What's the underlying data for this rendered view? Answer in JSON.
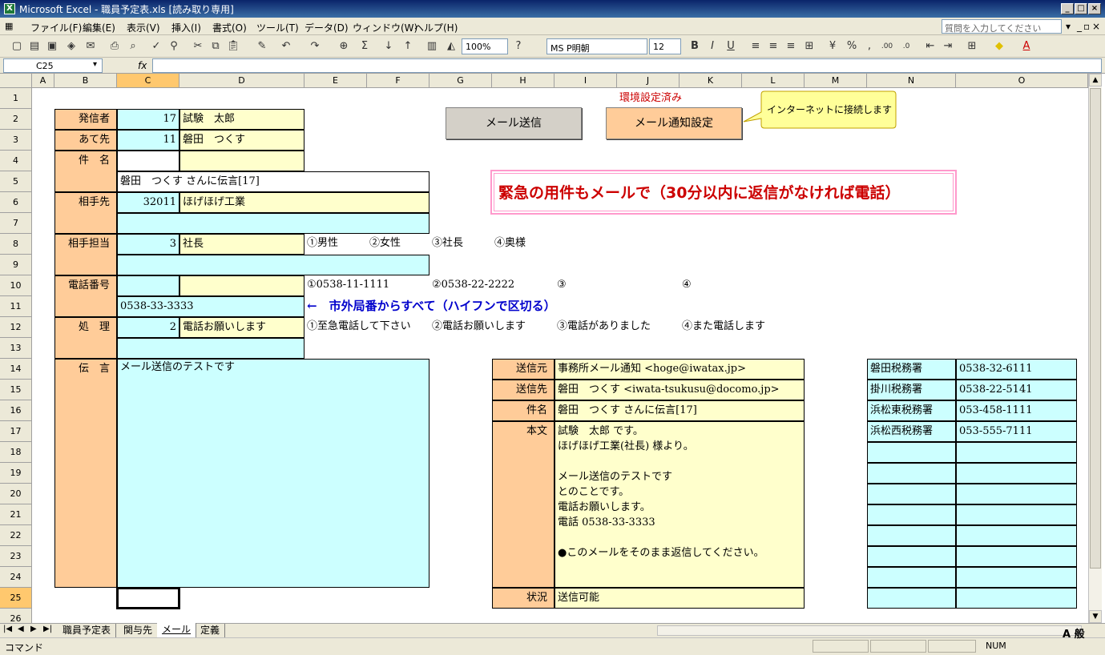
{
  "window": {
    "title": "Microsoft Excel - 職員予定表.xls  [読み取り専用]"
  },
  "menu": {
    "items": [
      "ファイル(F)",
      "編集(E)",
      "表示(V)",
      "挿入(I)",
      "書式(O)",
      "ツール(T)",
      "データ(D)",
      "ウィンドウ(W)",
      "ヘルプ(H)"
    ],
    "help_placeholder": "質問を入力してください"
  },
  "toolbar": {
    "zoom": "100%",
    "font_name": "MS P明朝",
    "font_size": "12"
  },
  "formula_bar": {
    "name_box": "C25",
    "fx": "fx"
  },
  "columns": [
    "A",
    "B",
    "C",
    "D",
    "E",
    "F",
    "G",
    "H",
    "I",
    "J",
    "K",
    "L",
    "M",
    "N",
    "O"
  ],
  "rows": [
    "1",
    "2",
    "3",
    "4",
    "5",
    "6",
    "7",
    "8",
    "9",
    "10",
    "11",
    "12",
    "13",
    "14",
    "15",
    "16",
    "17",
    "18",
    "19",
    "20",
    "21",
    "22",
    "23",
    "24",
    "25",
    "26"
  ],
  "form": {
    "sender_label": "発信者",
    "sender_id": "17",
    "sender_name": "試験　太郎",
    "to_label": "あて先",
    "to_id": "11",
    "to_name": "磐田　つくす",
    "subject_label": "件　名",
    "subject_value": "磐田　つくす さんに伝言[17]",
    "partner_label": "相手先",
    "partner_id": "32011",
    "partner_name": "ほげほげ工業",
    "contact_label": "相手担当",
    "contact_id": "3",
    "contact_name": "社長",
    "contact_options": [
      "①男性",
      "②女性",
      "③社長",
      "④奥様"
    ],
    "phone_label": "電話番号",
    "phone_value": "0538-33-3333",
    "phone_options": [
      "①0538-11-1111",
      "②0538-22-2222",
      "③",
      "④"
    ],
    "phone_hint": "←　市外局番からすべて（ハイフンで区切る）",
    "action_label": "処　理",
    "action_id": "2",
    "action_name": "電話お願いします",
    "action_options": [
      "①至急電話して下さい",
      "②電話お願いします",
      "③電話がありました",
      "④また電話します"
    ],
    "message_label": "伝　言",
    "message_value": "メール送信のテストです"
  },
  "buttons": {
    "send_mail": "メール送信",
    "notify_setting": "メール通知設定",
    "env_status": "環境設定済み",
    "callout": "インターネットに接続します"
  },
  "banner": "緊急の用件もメールで（30分以内に返信がなければ電話）",
  "preview": {
    "from_label": "送信元",
    "from_value": "事務所メール通知 <hoge@iwatax.jp>",
    "to_label": "送信先",
    "to_value": "磐田　つくす <iwata-tsukusu@docomo.jp>",
    "subject_label": "件名",
    "subject_value": "磐田　つくす さんに伝言[17]",
    "body_label": "本文",
    "body_lines": [
      "試験　太郎 です。",
      "ほげほげ工業(社長) 様より。",
      "",
      "メール送信のテストです",
      "とのことです。",
      "電話お願いします。",
      "電話 0538-33-3333",
      "",
      "●このメールをそのまま返信してください。"
    ],
    "status_label": "状況",
    "status_value": "送信可能"
  },
  "tax_offices": [
    {
      "name": "磐田税務署",
      "phone": "0538-32-6111"
    },
    {
      "name": "掛川税務署",
      "phone": "0538-22-5141"
    },
    {
      "name": "浜松東税務署",
      "phone": "053-458-1111"
    },
    {
      "name": "浜松西税務署",
      "phone": "053-555-7111"
    }
  ],
  "sheet_tabs": [
    "職員予定表",
    "関与先",
    "メール",
    "定義"
  ],
  "active_tab": "メール",
  "status": {
    "mode": "コマンド",
    "num": "NUM",
    "ime": "A 般"
  },
  "colors": {
    "orange": "#ffcc99",
    "cyan": "#ccffff",
    "yellow": "#ffffcc",
    "banner_red": "#cc0000",
    "hint_blue": "#0000cc"
  }
}
